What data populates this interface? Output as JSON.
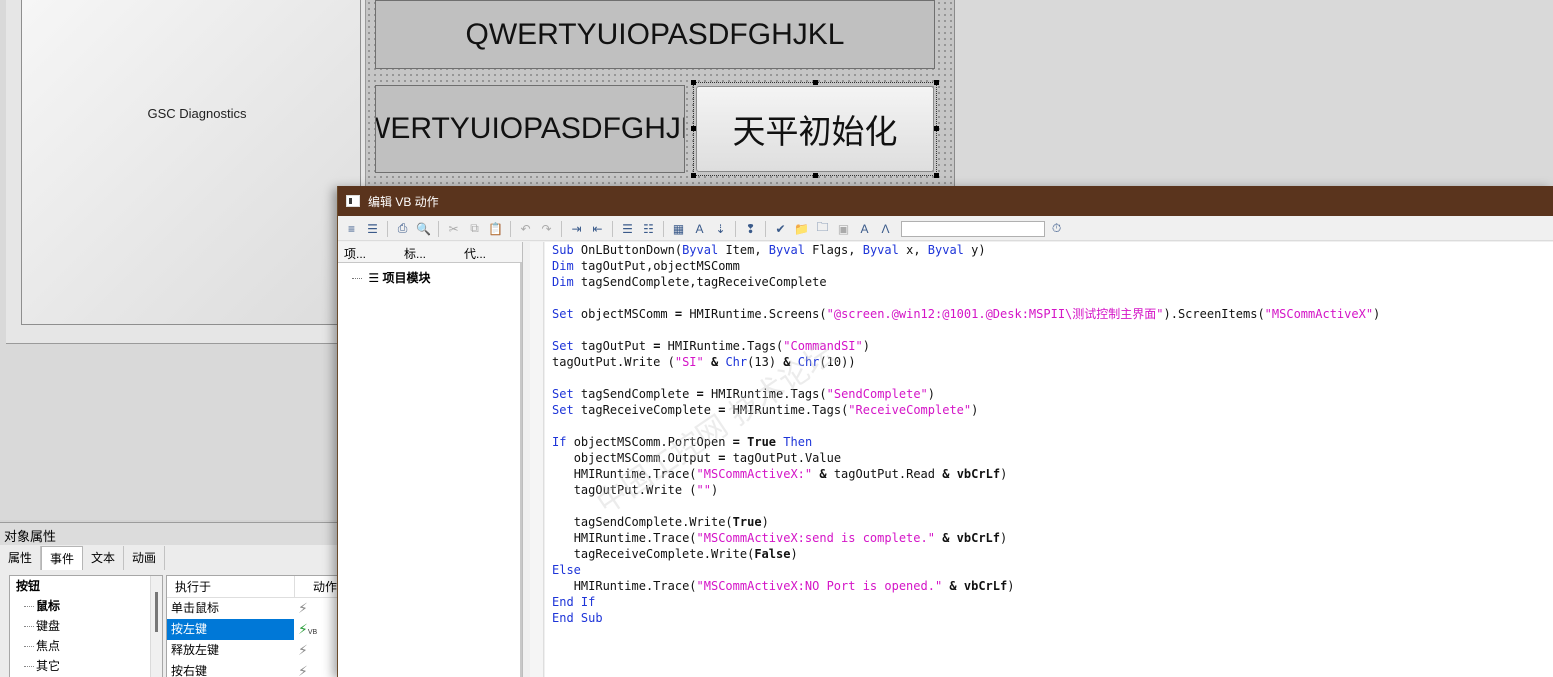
{
  "canvas": {
    "gsc_label": "GSC Diagnostics",
    "io_field_1": "QWERTYUIOPASDFGHJKL",
    "io_field_2": "WERTYUIOPASDFGHJKL",
    "init_button": "天平初始化"
  },
  "properties": {
    "title": "对象属性",
    "tabs": [
      "属性",
      "事件",
      "文本",
      "动画"
    ],
    "active_tab": "事件",
    "tree": [
      {
        "label": "按钮",
        "level": 0,
        "bold": true
      },
      {
        "label": "鼠标",
        "level": 1,
        "bold": true
      },
      {
        "label": "键盘",
        "level": 1,
        "bold": false
      },
      {
        "label": "焦点",
        "level": 1,
        "bold": false
      },
      {
        "label": "其它",
        "level": 1,
        "bold": false
      }
    ],
    "events_header": {
      "name": "执行于",
      "action": "动作"
    },
    "events": [
      {
        "name": "单击鼠标",
        "action_icon": "lightning-icon",
        "selected": false
      },
      {
        "name": "按左键",
        "action_icon": "lightning-vb-icon",
        "selected": true
      },
      {
        "name": "释放左键",
        "action_icon": "lightning-icon",
        "selected": false
      },
      {
        "name": "按右键",
        "action_icon": "lightning-icon",
        "selected": false
      }
    ]
  },
  "vb_editor": {
    "title": "编辑 VB 动作",
    "sidebar_tabs": [
      "项...",
      "标...",
      "代..."
    ],
    "tree_item": "项目模块",
    "code_lines": [
      "Sub OnLButtonDown(Byval Item, Byval Flags, Byval x, Byval y)",
      "Dim tagOutPut,objectMSComm",
      "Dim tagSendComplete,tagReceiveComplete",
      "",
      "Set objectMSComm = HMIRuntime.Screens(\"@screen.@win12:@1001.@Desk:MSPII\\测试控制主界面\").ScreenItems(\"MSCommActiveX\")",
      "",
      "Set tagOutPut = HMIRuntime.Tags(\"CommandSI\")",
      "tagOutPut.Write (\"SI\" & Chr(13) & Chr(10))",
      "",
      "Set tagSendComplete = HMIRuntime.Tags(\"SendComplete\")",
      "Set tagReceiveComplete = HMIRuntime.Tags(\"ReceiveComplete\")",
      "",
      "If objectMSComm.PortOpen = True Then",
      "   objectMSComm.Output = tagOutPut.Value",
      "   HMIRuntime.Trace(\"MSCommActiveX:\" & tagOutPut.Read & vbCrLf)",
      "   tagOutPut.Write (\"\")",
      "",
      "   tagSendComplete.Write(True)",
      "   HMIRuntime.Trace(\"MSCommActiveX:send is complete.\" & vbCrLf)",
      "   tagReceiveComplete.Write(False)",
      "Else",
      "   HMIRuntime.Trace(\"MSCommActiveX:NO Port is opened.\" & vbCrLf)",
      "End If",
      "End Sub"
    ],
    "colors": {
      "titlebar": "#5a341d",
      "keyword": "#1d34d8",
      "string": "#d414c7",
      "selection": "#0078d7"
    }
  }
}
